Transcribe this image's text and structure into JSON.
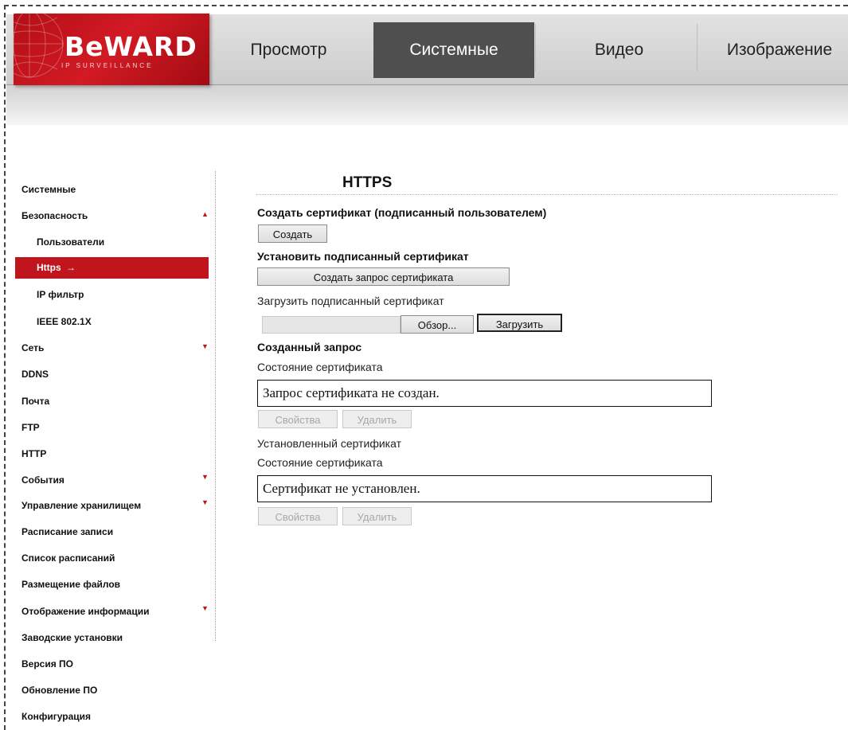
{
  "brand": {
    "logo_main": "BeWARD",
    "logo_sub": "IP SURVEILLANCE",
    "colors": {
      "brand_red": "#c0151d",
      "tab_active": "#4f4f4f"
    }
  },
  "nav": {
    "tabs": [
      "Просмотр",
      "Системные",
      "Видео",
      "Изображение"
    ],
    "active_tab": "Системные"
  },
  "sidebar": {
    "items": [
      {
        "label": "Системные"
      },
      {
        "label": "Безопасность",
        "arrow": "▲"
      },
      {
        "label": "Пользователи"
      },
      {
        "label": "Https",
        "suffix": "→",
        "active": true
      },
      {
        "label": "IP фильтр"
      },
      {
        "label": "IEEE 802.1X"
      },
      {
        "label": "Сеть",
        "arrow": "▼"
      },
      {
        "label": "DDNS"
      },
      {
        "label": "Почта"
      },
      {
        "label": "FTP"
      },
      {
        "label": "HTTP"
      },
      {
        "label": "События",
        "arrow": "▼"
      },
      {
        "label": "Управление хранилищем",
        "arrow": "▼"
      },
      {
        "label": "Расписание записи"
      },
      {
        "label": "Список расписаний"
      },
      {
        "label": "Размещение файлов"
      },
      {
        "label": "Отображение информации",
        "arrow": "▼"
      },
      {
        "label": "Заводские установки"
      },
      {
        "label": "Версия ПО"
      },
      {
        "label": "Обновление ПО"
      },
      {
        "label": "Конфигурация"
      }
    ]
  },
  "content": {
    "title": "HTTPS",
    "create_cert_heading": "Создать сертификат (подписанный пользователем)",
    "create_button": "Создать",
    "install_heading": "Установить подписанный сертификат",
    "create_request_button": "Создать запрос сертификата",
    "upload_label": "Загрузить подписанный сертификат",
    "browse_button": "Обзор...",
    "upload_button": "Загрузить",
    "created_request_heading": "Созданный запрос",
    "cert_state_label_1": "Состояние сертификата",
    "request_status": "Запрос сертификата не создан.",
    "properties_button_1": "Свойства",
    "delete_button_1": "Удалить",
    "installed_cert_label": "Установленный сертификат",
    "cert_state_label_2": "Состояние сертификата",
    "installed_status": "Сертификат не установлен.",
    "properties_button_2": "Свойства",
    "delete_button_2": "Удалить"
  }
}
